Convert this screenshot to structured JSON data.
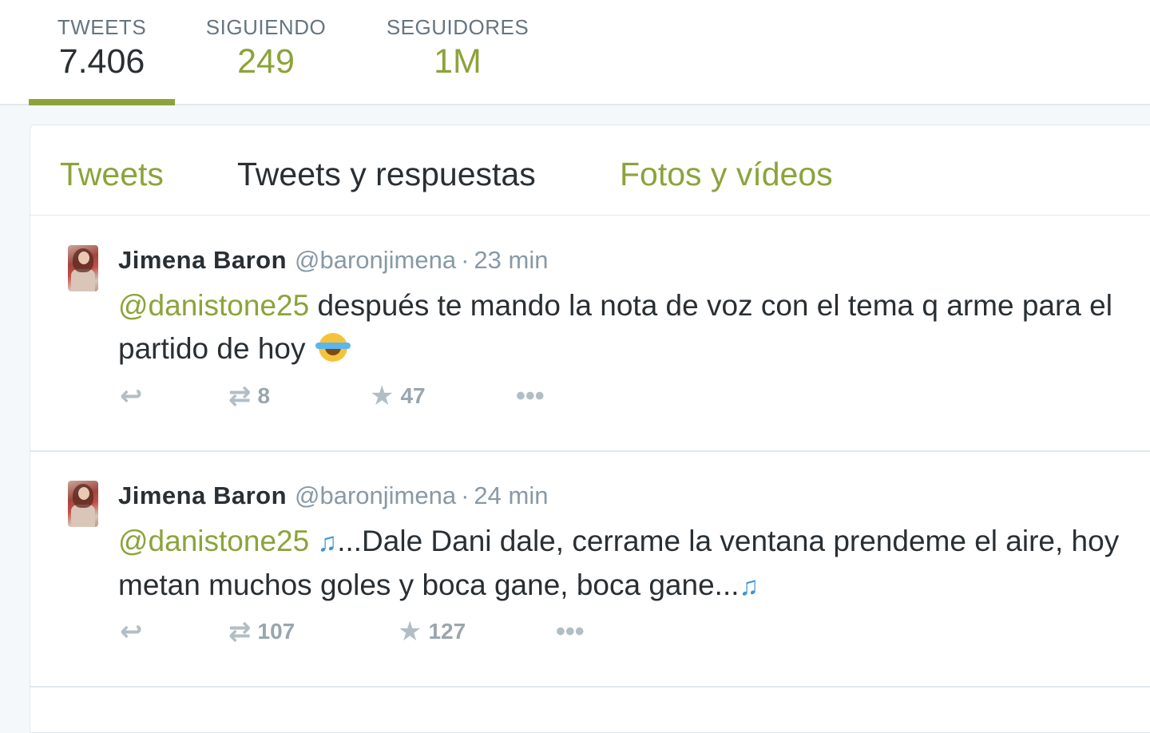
{
  "stats": {
    "tweets": {
      "label": "TWEETS",
      "value": "7.406"
    },
    "following": {
      "label": "SIGUIENDO",
      "value": "249"
    },
    "followers": {
      "label": "SEGUIDORES",
      "value": "1M"
    }
  },
  "tabs": [
    {
      "label": "Tweets"
    },
    {
      "label": "Tweets y respuestas"
    },
    {
      "label": "Fotos y vídeos"
    }
  ],
  "tweets": [
    {
      "name": "Jimena Baron",
      "handle": "@baronjimena",
      "separator": "·",
      "time": "23 min",
      "mention": "@danistone25",
      "text": " después te mando la nota de voz con el tema q arme para el partido de hoy ",
      "text_end": "",
      "retweets": "8",
      "favorites": "47",
      "icons": {
        "reply": "reply-icon",
        "retweet": "retweet-icon",
        "favorite": "star-icon",
        "more": "more-icon",
        "emoji": "tears-of-joy-emoji"
      }
    },
    {
      "name": "Jimena Baron",
      "handle": "@baronjimena",
      "separator": "·",
      "time": "24 min",
      "mention": "@danistone25",
      "text": "...Dale Dani dale, cerrame la ventana prendeme el aire, hoy metan muchos goles y boca gane, boca gane...",
      "text_end": "",
      "retweets": "107",
      "favorites": "127",
      "icons": {
        "reply": "reply-icon",
        "retweet": "retweet-icon",
        "favorite": "star-icon",
        "more": "more-icon",
        "emoji": "music-notes-emoji"
      }
    }
  ],
  "colors": {
    "accent": "#8ca33a",
    "text": "#292f33",
    "muted": "#8899a6",
    "background": "#f5f8fa"
  }
}
